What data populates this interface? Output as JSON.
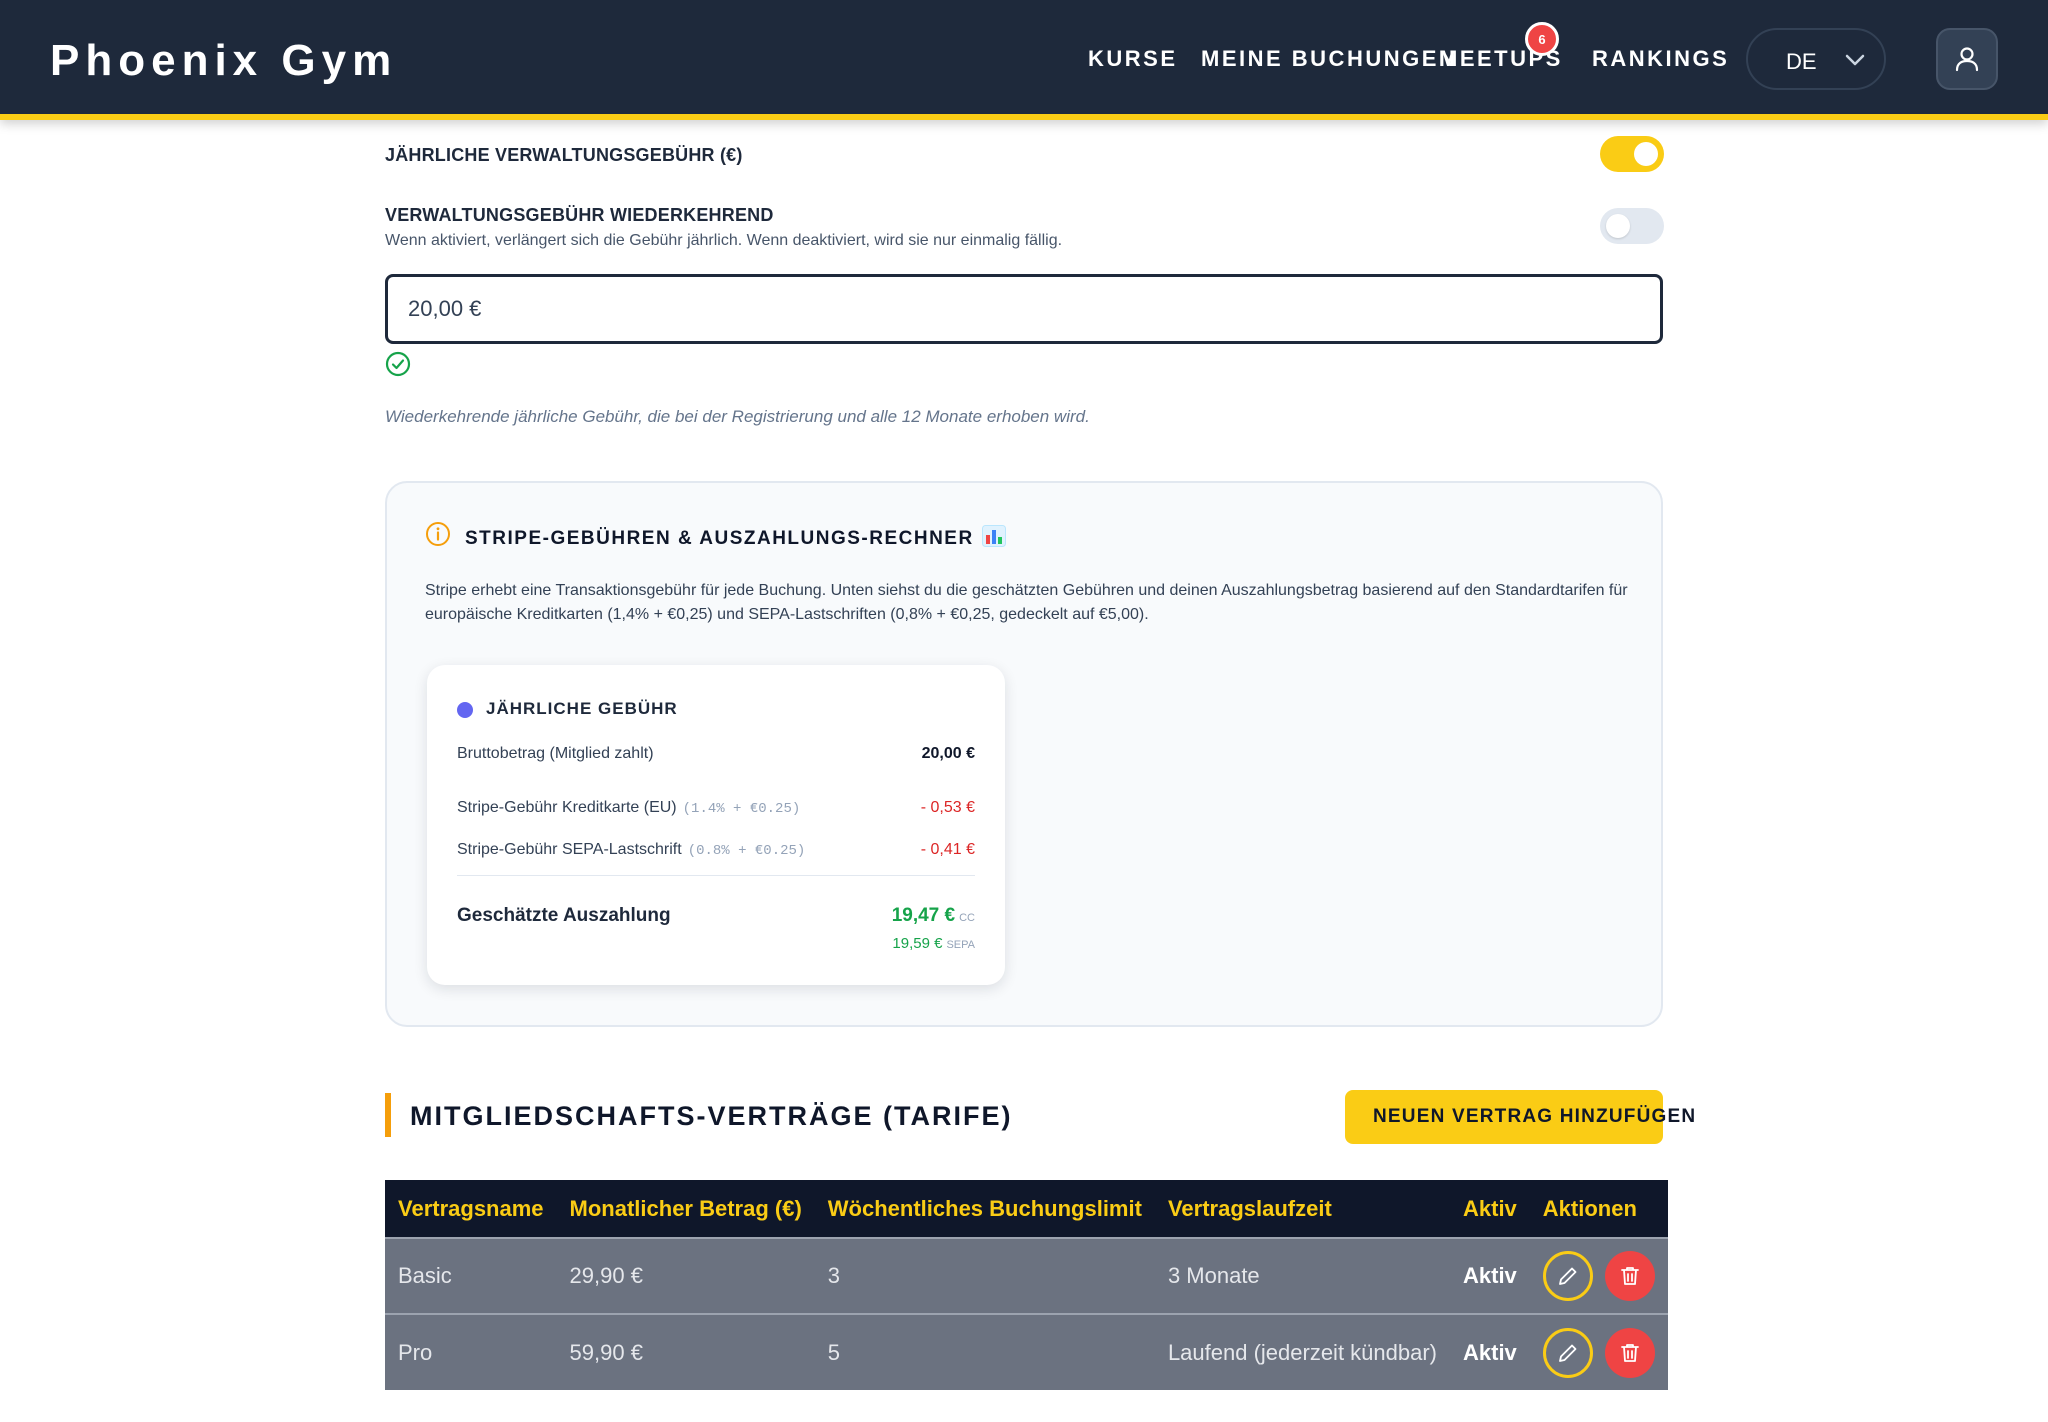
{
  "header": {
    "logo": "Phoenix Gym",
    "nav": [
      "KURSE",
      "MEINE BUCHUNGEN",
      "MEETUPS",
      "RANKINGS"
    ],
    "meetups_badge": "6",
    "language": "DE"
  },
  "fee_settings": {
    "annual_fee_label": "JÄHRLICHE VERWALTUNGSGEBÜHR (€)",
    "annual_fee_enabled": true,
    "recurring_label": "VERWALTUNGSGEBÜHR WIEDERKEHREND",
    "recurring_help": "Wenn aktiviert, verlängert sich die Gebühr jährlich. Wenn deaktiviert, wird sie nur einmalig fällig.",
    "recurring_enabled": false,
    "fee_value": "20,00 €",
    "hint": "Wiederkehrende jährliche Gebühr, die bei der Registrierung und alle 12 Monate erhoben wird."
  },
  "stripe_calculator": {
    "title": "STRIPE-GEBÜHREN & AUSZAHLUNGS-RECHNER",
    "description": "Stripe erhebt eine Transaktionsgebühr für jede Buchung. Unten siehst du die geschätzten Gebühren und deinen Auszahlungsbetrag basierend auf den Standardtarifen für europäische Kreditkarten (1,4% + €0,25) und SEPA-Lastschriften (0,8% + €0,25, gedeckelt auf €5,00).",
    "card": {
      "title": "JÄHRLICHE GEBÜHR",
      "gross_label": "Bruttobetrag (Mitglied zahlt)",
      "gross_value": "20,00 €",
      "cc_label": "Stripe-Gebühr Kreditkarte (EU)",
      "cc_rate": "(1.4% + €0.25)",
      "cc_value": "- 0,53 €",
      "sepa_label": "Stripe-Gebühr SEPA-Lastschrift",
      "sepa_rate": "(0.8% + €0.25)",
      "sepa_value": "- 0,41 €",
      "payout_label": "Geschätzte Auszahlung",
      "payout_cc": "19,47 €",
      "payout_cc_tag": "CC",
      "payout_sepa": "19,59 €",
      "payout_sepa_tag": "SEPA"
    }
  },
  "contracts": {
    "title": "MITGLIEDSCHAFTS-VERTRÄGE (TARIFE)",
    "add_button": "NEUEN VERTRAG HINZUFÜGEN",
    "columns": [
      "Vertragsname",
      "Monatlicher Betrag (€)",
      "Wöchentliches Buchungslimit",
      "Vertragslaufzeit",
      "Aktiv",
      "Aktionen"
    ],
    "rows": [
      {
        "name": "Basic",
        "amount": "29,90 €",
        "limit": "3",
        "term": "3 Monate",
        "active": "Aktiv"
      },
      {
        "name": "Pro",
        "amount": "59,90 €",
        "limit": "5",
        "term": "Laufend (jederzeit kündbar)",
        "active": "Aktiv"
      }
    ]
  }
}
